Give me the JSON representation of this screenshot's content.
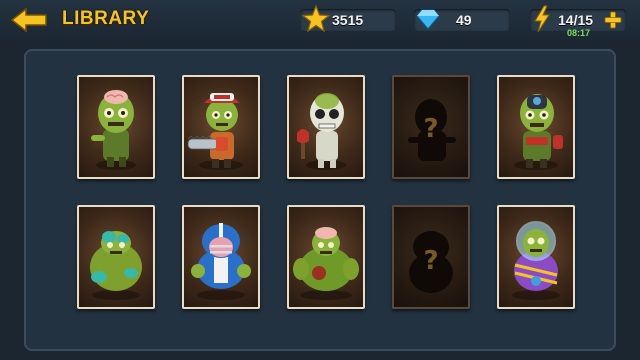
{
  "header": {
    "title": "LIBRARY",
    "back_icon": "arrow-left-icon"
  },
  "currency": {
    "stars": "3515",
    "gems": "49",
    "energy": "14/15",
    "energy_timer": "08:17"
  },
  "colors": {
    "accent_yellow": "#f7c321",
    "timer_green": "#7fe05a",
    "gem_blue": "#39b7f0",
    "card_border": "#e8dcc4"
  },
  "grid": {
    "rows": [
      [
        {
          "name": "zombie-brain",
          "locked": false
        },
        {
          "name": "zombie-chainsaw",
          "locked": false
        },
        {
          "name": "zombie-skeleton-axe",
          "locked": false
        },
        {
          "name": "zombie-locked",
          "locked": true
        },
        {
          "name": "zombie-gasmask",
          "locked": false
        }
      ],
      [
        {
          "name": "zombie-fat-green",
          "locked": false
        },
        {
          "name": "zombie-football",
          "locked": false
        },
        {
          "name": "zombie-brute",
          "locked": false
        },
        {
          "name": "zombie-locked",
          "locked": true
        },
        {
          "name": "zombie-astronaut",
          "locked": false
        }
      ]
    ]
  }
}
